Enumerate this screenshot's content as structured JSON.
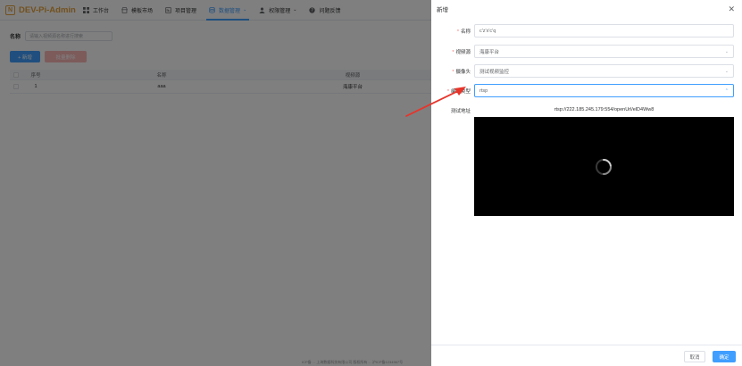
{
  "app": {
    "brand": "DEV-Pi-Admin",
    "logo_glyph": "N"
  },
  "nav": [
    {
      "label": "工作台",
      "icon": "grid-icon"
    },
    {
      "label": "模板市场",
      "icon": "store-icon"
    },
    {
      "label": "项目管理",
      "icon": "project-icon"
    },
    {
      "label": "数据管理",
      "icon": "database-icon",
      "active": true
    },
    {
      "label": "权限管理",
      "icon": "user-icon"
    },
    {
      "label": "问题反馈",
      "icon": "question-icon"
    }
  ],
  "search": {
    "label": "名称",
    "placeholder": "请输入视频源名称进行搜索"
  },
  "toolbar": {
    "add": "+ 新增",
    "batch_delete": "批量删除"
  },
  "table": {
    "headers": [
      "序号",
      "名称",
      "视频源"
    ],
    "rows": [
      {
        "index": "1",
        "name": "aaa",
        "source": "海康平台"
      }
    ]
  },
  "footer": "ICP备 ... 上海数据科技有限公司 版权所有 ... 沪ICP备1234567号",
  "drawer": {
    "title": "新增",
    "fields": {
      "name": {
        "label": "名称",
        "value": "c'z'x'c'q"
      },
      "source": {
        "label": "视频源",
        "value": "海康平台"
      },
      "camera": {
        "label": "摄像头",
        "value": "测试视频监控"
      },
      "codec": {
        "label": "编码类型",
        "value": "rtsp"
      }
    },
    "test": {
      "label": "测试地址",
      "url": "rtsp://222.185.245.179:554/openUrl/elD4Ww8"
    },
    "cancel": "取消",
    "ok": "确定"
  },
  "colors": {
    "primary": "#409eff",
    "brand": "#e6a23c",
    "danger_light": "#fab6b6",
    "required": "#f56c6c",
    "annotation_arrow": "#e8342a"
  }
}
